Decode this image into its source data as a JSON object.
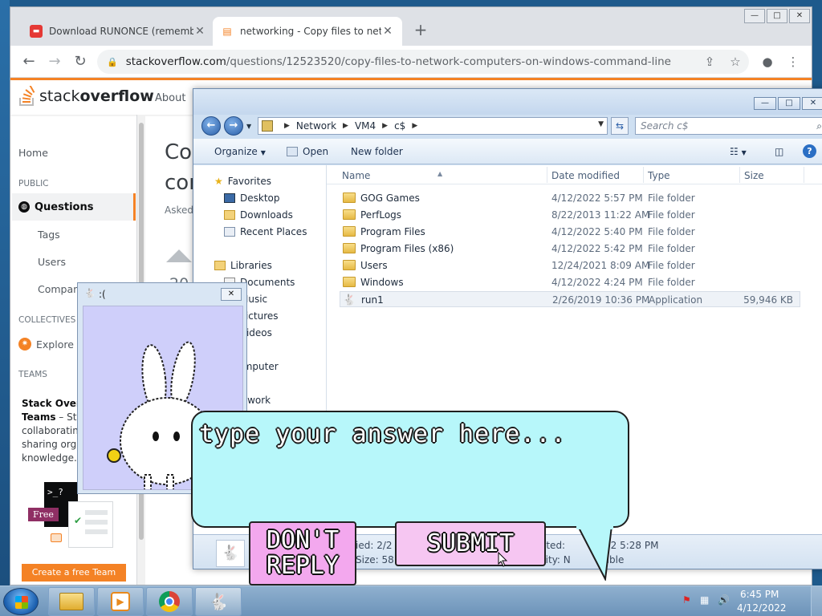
{
  "chrome": {
    "tabs": [
      {
        "label": "Download RUNONCE (remembe"
      },
      {
        "label": "networking - Copy files to netwo"
      }
    ],
    "url_domain": "stackoverflow.com",
    "url_path": "/questions/12523520/copy-files-to-network-computers-on-windows-command-line"
  },
  "so": {
    "logo_a": "stack",
    "logo_b": "overflow",
    "about": "About",
    "nav": {
      "home": "Home",
      "public": "PUBLIC",
      "questions": "Questions",
      "tags": "Tags",
      "users": "Users",
      "companies": "Companies",
      "collectives": "COLLECTIVES",
      "explore": "Explore C",
      "teams": "TEAMS"
    },
    "title_line1": "Cop",
    "title_line2": "cor",
    "asked": "Asked",
    "vote": "20",
    "teams_title": "Stack Overf",
    "teams_title2": "Teams",
    "teams_dash": " – Sta",
    "teams_l1": "collaborating",
    "teams_l2": "sharing orga",
    "teams_l3": "knowledge.",
    "cmd_prompt": ">_?",
    "free": "Free",
    "create_team": "Create a free Team"
  },
  "explorer": {
    "crumbs": [
      "Network",
      "VM4",
      "c$"
    ],
    "search_placeholder": "Search c$",
    "organize": "Organize",
    "open": "Open",
    "new_folder": "New folder",
    "nav": {
      "favorites": "Favorites",
      "desktop": "Desktop",
      "downloads": "Downloads",
      "recent": "Recent Places",
      "libraries": "Libraries",
      "documents": "Documents",
      "music": "Music",
      "pictures": "Pictures",
      "videos": "Videos",
      "computer": "Computer",
      "network": "Network"
    },
    "columns": {
      "name": "Name",
      "date": "Date modified",
      "type": "Type",
      "size": "Size"
    },
    "files": [
      {
        "name": "GOG Games",
        "date": "4/12/2022 5:57 PM",
        "type": "File folder",
        "size": ""
      },
      {
        "name": "PerfLogs",
        "date": "8/22/2013 11:22 AM",
        "type": "File folder",
        "size": ""
      },
      {
        "name": "Program Files",
        "date": "4/12/2022 5:40 PM",
        "type": "File folder",
        "size": ""
      },
      {
        "name": "Program Files (x86)",
        "date": "4/12/2022 5:42 PM",
        "type": "File folder",
        "size": ""
      },
      {
        "name": "Users",
        "date": "12/24/2021 8:09 AM",
        "type": "File folder",
        "size": ""
      },
      {
        "name": "Windows",
        "date": "4/12/2022 4:24 PM",
        "type": "File folder",
        "size": ""
      },
      {
        "name": "run1",
        "date": "2/26/2019 10:36 PM",
        "type": "Application",
        "size": "59,946 KB"
      }
    ],
    "details": {
      "modified": "ied: 2/2",
      "size": "Size: 58.",
      "created": "ated:",
      "created_val": "22 5:28 PM",
      "avail": "ility: N",
      "avail_val": "ilable"
    }
  },
  "bunny": {
    "title": ":(",
    "prompt": "type your answer here...",
    "dont_reply_1": "DON'T",
    "dont_reply_2": "REPLY",
    "submit": "SUBMIT",
    "colors": {
      "bubble": "#b7f7fa",
      "dont": "#f3a8ee",
      "submit": "#f6c6f2",
      "panel": "#cfcffa"
    }
  },
  "taskbar": {
    "time": "6:45 PM",
    "date": "4/12/2022"
  }
}
